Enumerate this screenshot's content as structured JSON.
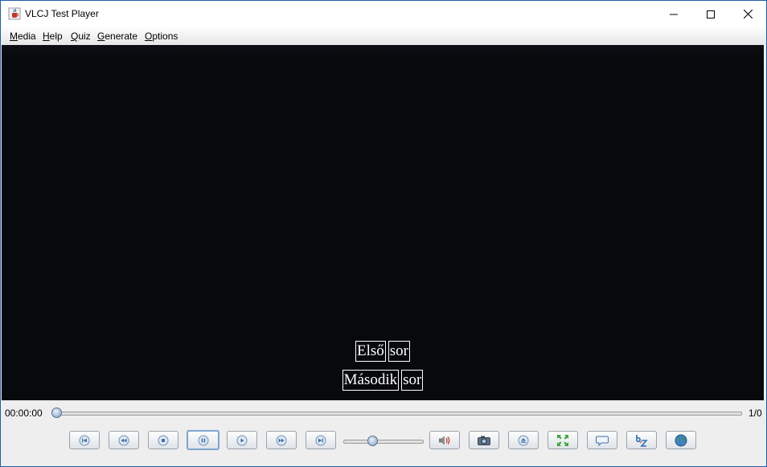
{
  "window": {
    "title": "VLCJ Test Player"
  },
  "menu": [
    {
      "mnemonic": "M",
      "rest": "edia"
    },
    {
      "mnemonic": "H",
      "rest": "elp"
    },
    {
      "mnemonic": "Q",
      "rest": "uiz"
    },
    {
      "mnemonic": "G",
      "rest": "enerate"
    },
    {
      "mnemonic": "O",
      "rest": "ptions"
    }
  ],
  "subtitles": [
    [
      "Első",
      "sor"
    ],
    [
      "Második",
      "sor"
    ]
  ],
  "playback": {
    "time": "00:00:00",
    "chapter": "1/0",
    "position": 0,
    "volume": 0.37
  },
  "colors": {
    "accent": "#1e5fa8",
    "video_bg": "#07090c"
  },
  "buttons": [
    {
      "name": "previous-chapter-button",
      "icon": "skip-previous-icon"
    },
    {
      "name": "rewind-button",
      "icon": "rewind-icon"
    },
    {
      "name": "stop-button",
      "icon": "stop-icon"
    },
    {
      "name": "pause-button",
      "icon": "pause-icon",
      "active": true
    },
    {
      "name": "play-button",
      "icon": "play-icon"
    },
    {
      "name": "fast-forward-button",
      "icon": "fast-forward-icon"
    },
    {
      "name": "next-chapter-button",
      "icon": "skip-next-icon"
    },
    {
      "name": "mute-button",
      "icon": "speaker-icon"
    },
    {
      "name": "snapshot-button",
      "icon": "camera-icon"
    },
    {
      "name": "eject-button",
      "icon": "eject-icon"
    },
    {
      "name": "fullscreen-button",
      "icon": "fullscreen-icon"
    },
    {
      "name": "subtitles-button",
      "icon": "speech-bubble-icon"
    },
    {
      "name": "subtitle-track-button",
      "icon": "subtitle-track-icon"
    },
    {
      "name": "connect-button",
      "icon": "globe-icon"
    }
  ]
}
